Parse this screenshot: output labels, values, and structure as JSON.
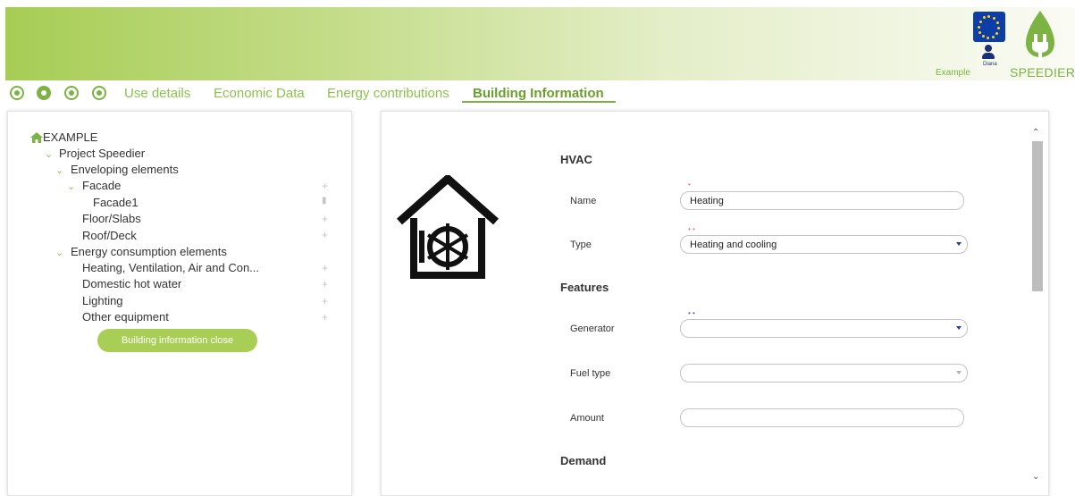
{
  "header": {
    "user_name": "Diana",
    "project_label": "Example",
    "brand": "SPEEDIER"
  },
  "tabs": [
    {
      "label": "Use details"
    },
    {
      "label": "Economic Data"
    },
    {
      "label": "Energy contributions"
    },
    {
      "label": "Building Information",
      "active": true
    }
  ],
  "tab_icons": [
    "home-icon",
    "building-icon",
    "bulb-icon",
    "target-icon"
  ],
  "tree": {
    "root": "EXAMPLE",
    "project": "Project Speedier",
    "enveloping": "Enveloping elements",
    "facade": "Facade",
    "facade1": "Facade1",
    "floor": "Floor/Slabs",
    "roof": "Roof/Deck",
    "energy": "Energy consumption elements",
    "hvac": "Heating, Ventilation, Air and Con...",
    "dhw": "Domestic hot water",
    "lighting": "Lighting",
    "other": "Other equipment",
    "close_button": "Building information close"
  },
  "form": {
    "hvac_title": "HVAC",
    "name_label": "Name",
    "name_value": "Heating",
    "type_label": "Type",
    "type_value": "Heating and cooling",
    "features_title": "Features",
    "generator_label": "Generator",
    "generator_value": "",
    "fuel_label": "Fuel type",
    "fuel_value": "",
    "amount_label": "Amount",
    "amount_value": "",
    "demand_title": "Demand"
  },
  "colors": {
    "brand_green": "#7cb342",
    "button_green": "#a9ce55",
    "eu_blue": "#0d3ea8"
  }
}
